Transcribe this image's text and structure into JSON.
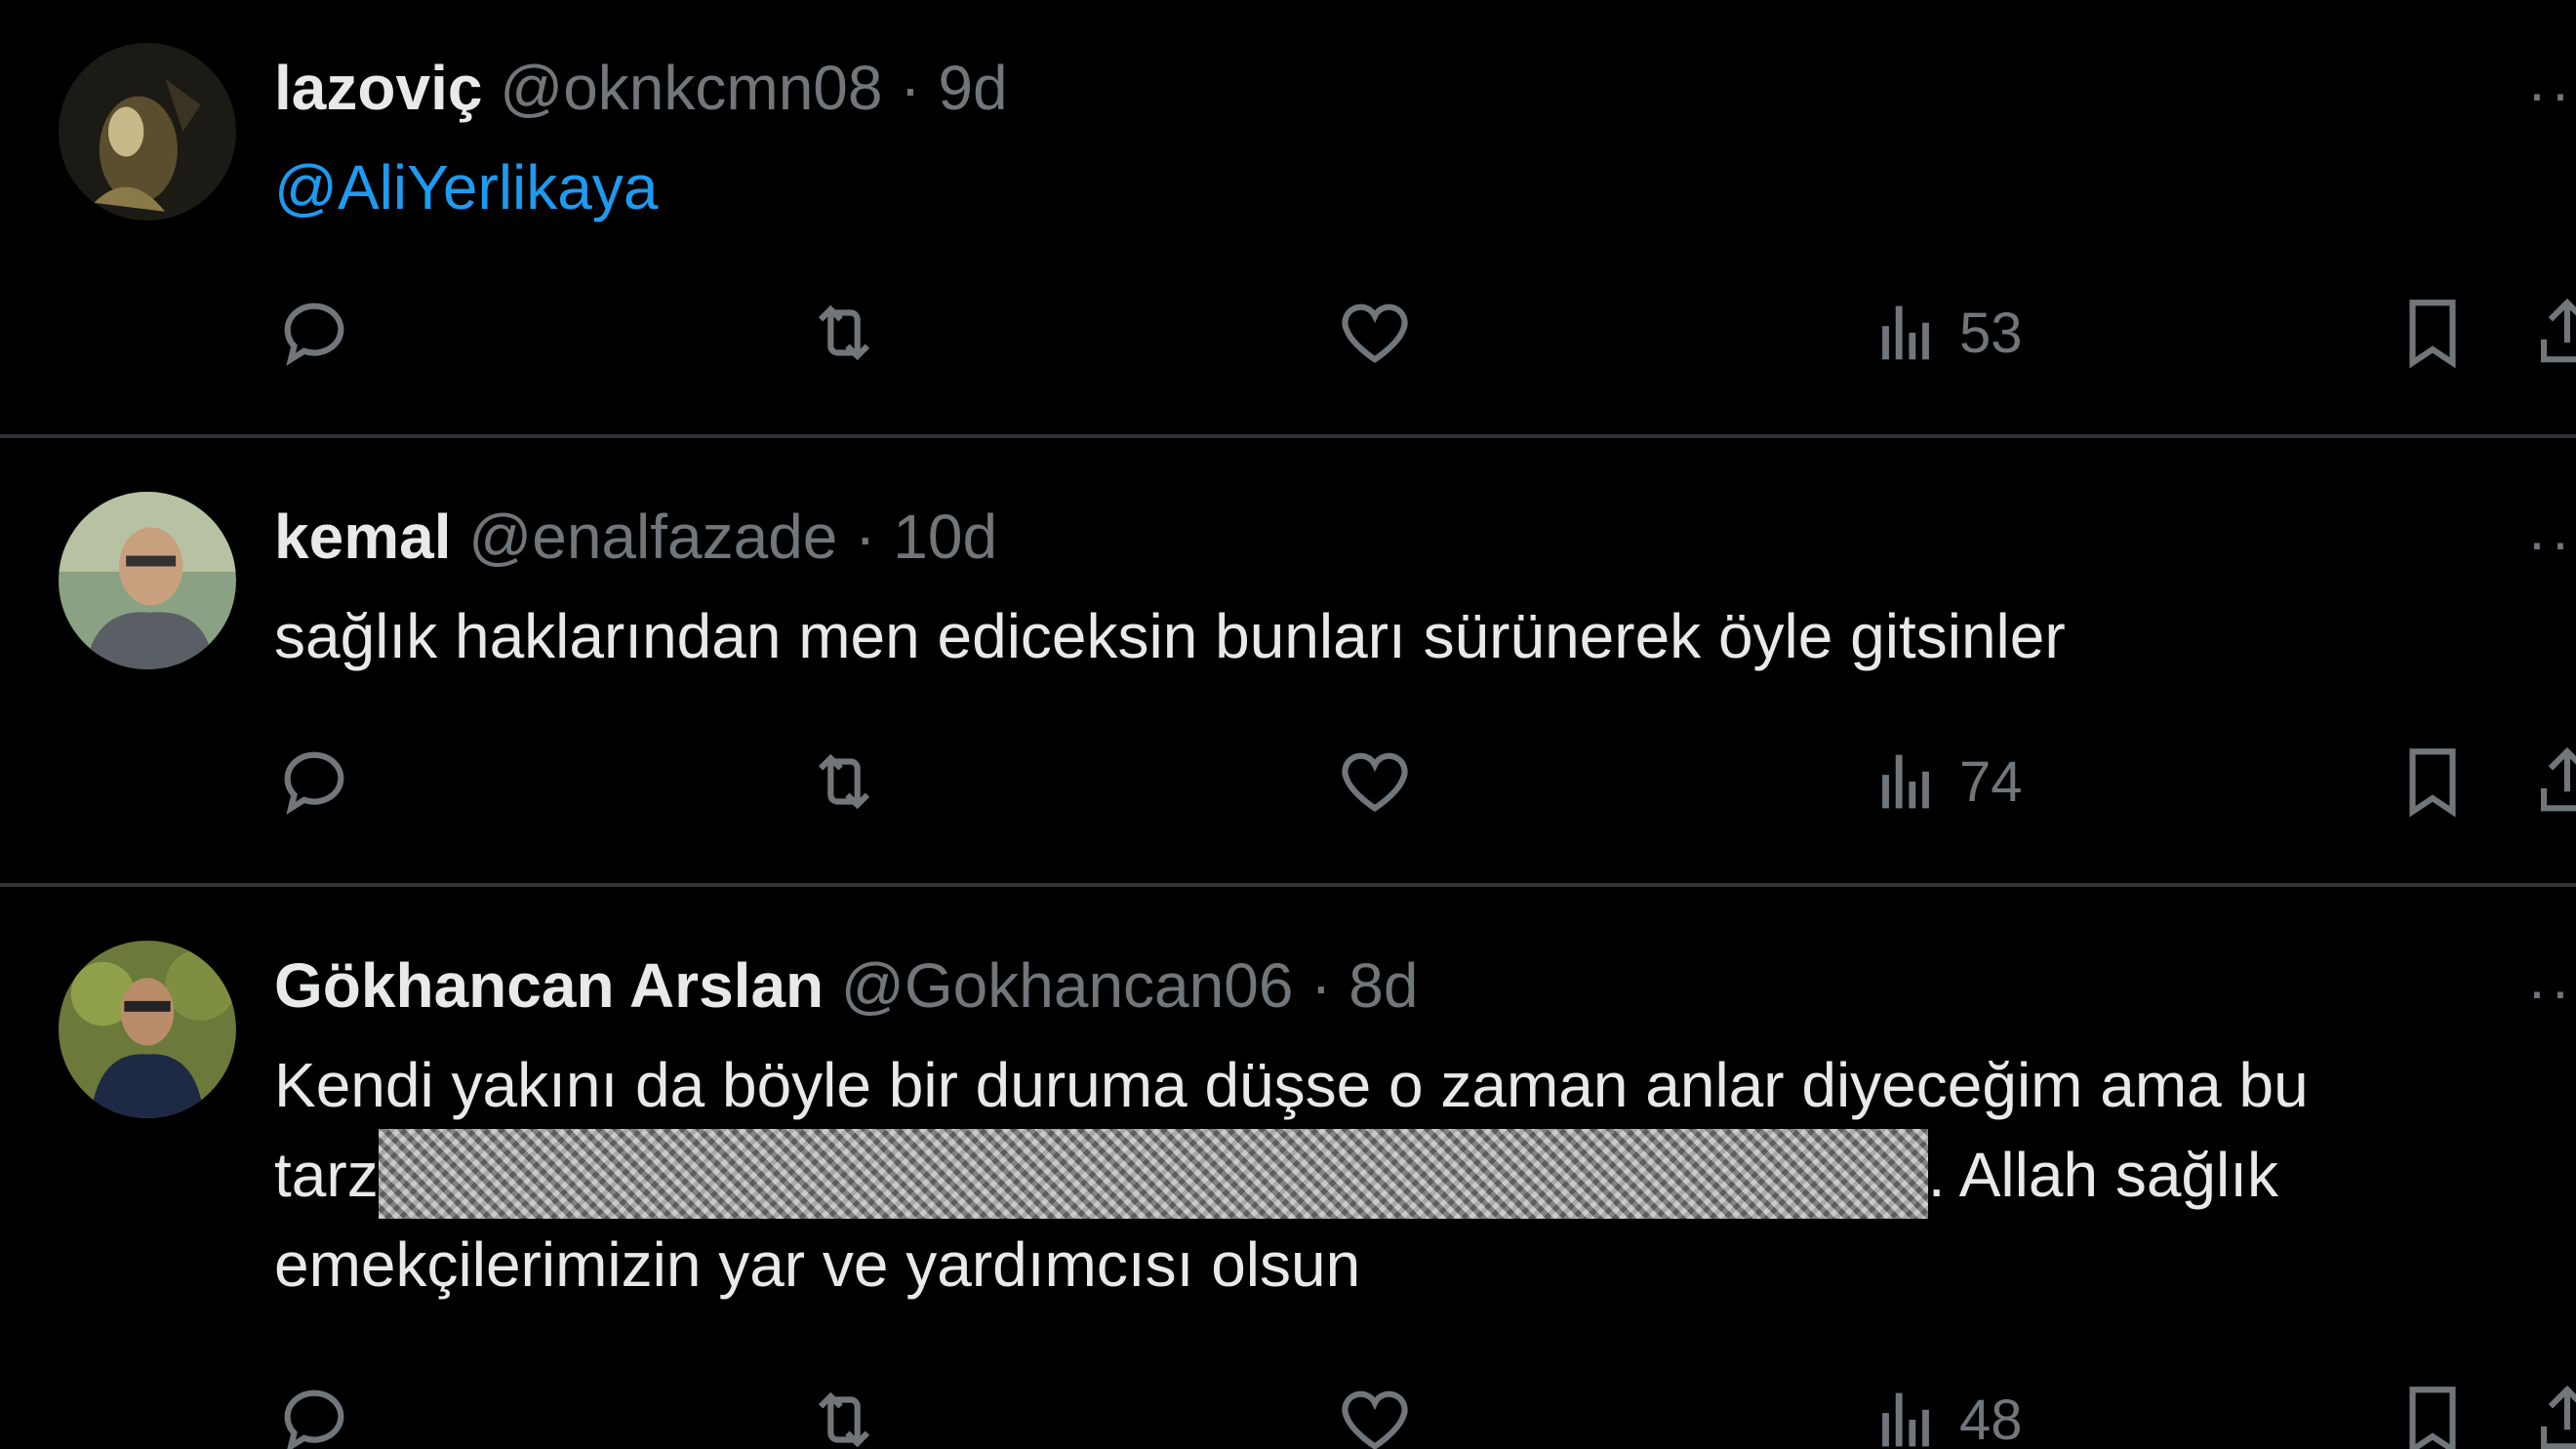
{
  "colors": {
    "background": "#000000",
    "text": "#e7e9ea",
    "muted": "#71767b",
    "link": "#1d9bf0",
    "divider": "#2f3336"
  },
  "tweets": [
    {
      "name": "lazoviç",
      "handle": "@oknkcmn08",
      "separator": "·",
      "time": "9d",
      "text_mention": "@AliYerlikaya",
      "actions": {
        "reply_icon": "reply-icon",
        "retweet_icon": "retweet-icon",
        "like_icon": "heart-icon",
        "views_icon": "views-chart-icon",
        "views_count": "53",
        "bookmark_icon": "bookmark-icon",
        "share_icon": "share-icon"
      },
      "more_label": "··"
    },
    {
      "name": "kemal",
      "handle": "@enalfazade",
      "separator": "·",
      "time": "10d",
      "text": "sağlık haklarından men ediceksin bunları sürünerek öyle gitsinler",
      "actions": {
        "views_count": "74"
      },
      "more_label": "··"
    },
    {
      "name": "Gökhancan Arslan",
      "handle": "@Gokhancan06",
      "separator": "·",
      "time": "8d",
      "text_line1": "Kendi yakını da böyle bir duruma düşse o zaman anlar diyeceğim ama bu",
      "text_line2_start": "tarz",
      "text_line2_end": ". Allah sağlık",
      "text_line3": "emekçilerimizin yar ve yardımcısı olsun",
      "actions": {
        "views_count": "48"
      },
      "more_label": "··"
    }
  ]
}
